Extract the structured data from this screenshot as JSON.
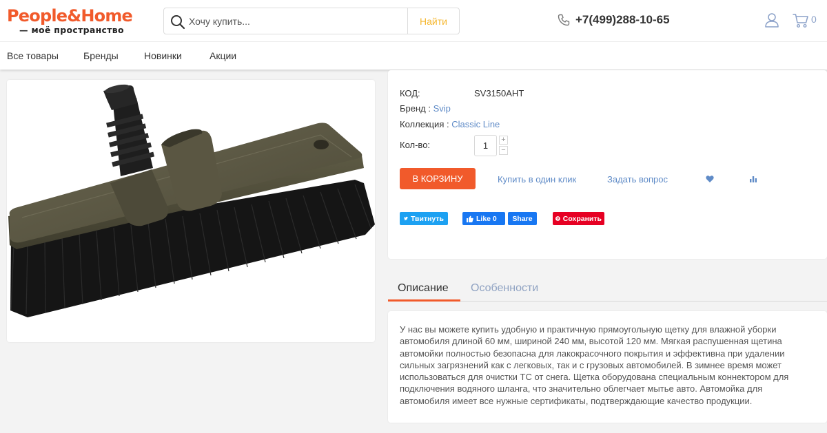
{
  "header": {
    "logo_main": "People&Home",
    "logo_sub": "— моё пространство",
    "search_placeholder": "Хочу купить...",
    "search_button": "Найти",
    "phone": "+7(499)288-10-65",
    "cart_count": "0"
  },
  "nav": {
    "items": [
      "Все товары",
      "Бренды",
      "Новинки",
      "Акции"
    ]
  },
  "product": {
    "code_label": "КОД:",
    "code_value": "SV3150AHT",
    "brand_label": "Бренд :",
    "brand_value": "Svip",
    "collection_label": "Коллекция :",
    "collection_value": "Classic Line",
    "qty_label": "Кол-во:",
    "qty_value": "1",
    "qty_plus": "+",
    "qty_minus": "−",
    "add_to_cart": "В КОРЗИНУ",
    "buy_one_click": "Купить в один клик",
    "ask_question": "Задать вопрос"
  },
  "social": {
    "tweet": "Твитнуть",
    "like": "Like 0",
    "share": "Share",
    "save": "Сохранить",
    "colors": {
      "twitter": "#1da1f2",
      "facebook": "#1877f2",
      "pinterest": "#e60023"
    }
  },
  "tabs": {
    "description": "Описание",
    "features": "Особенности"
  },
  "description": "У нас вы можете купить удобную и практичную прямоугольную щетку для влажной уборки автомобиля длиной 60 мм, шириной 240 мм, высотой 120 мм. Мягкая распушенная щетина автомойки полностью безопасна для лакокрасочного покрытия и эффективна при удалении сильных загрязнений как с легковых, так и с грузовых автомобилей. В зимнее время может использоваться для очистки ТС от снега. Щетка оборудована специальным коннектором для подключения водяного шланга, что значительно облегчает мытье авто. Автомойка для автомобиля имеет все нужные сертификаты, подтверждающие качество продукции.",
  "colors": {
    "brand": "#f15a2b",
    "link": "#5f8bc7",
    "search_button": "#f5b72f"
  }
}
